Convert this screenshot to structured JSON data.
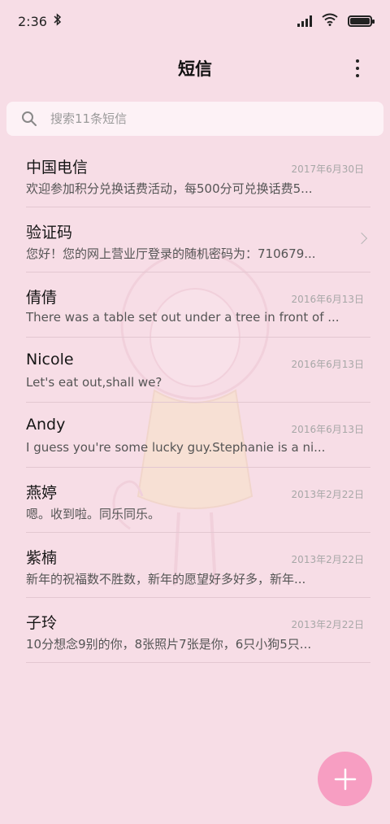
{
  "status_bar": {
    "time": "2:36",
    "bluetooth_icon": "bluetooth-icon",
    "signal_icon": "signal-icon",
    "wifi_icon": "wifi-icon",
    "battery_icon": "battery-icon"
  },
  "header": {
    "title": "短信",
    "menu_icon": "more-vertical-icon"
  },
  "search": {
    "placeholder": "搜索11条短信",
    "icon": "search-icon"
  },
  "messages": [
    {
      "name": "中国电信",
      "date": "2017年6月30日",
      "preview": "欢迎参加积分兑换话费活动，每500分可兑换话费5..."
    },
    {
      "name": "验证码",
      "date": "",
      "preview": "您好！您的网上营业厅登录的随机密码为：710679...",
      "has_chevron": true
    },
    {
      "name": "倩倩",
      "date": "2016年6月13日",
      "preview": "There was a table set out under a tree in front of ..."
    },
    {
      "name": "Nicole",
      "date": "2016年6月13日",
      "preview": "Let's eat out,shall we?"
    },
    {
      "name": "Andy",
      "date": "2016年6月13日",
      "preview": "I guess you're some lucky guy.Stephanie is a ni..."
    },
    {
      "name": "燕婷",
      "date": "2013年2月22日",
      "preview": "嗯。收到啦。同乐同乐。"
    },
    {
      "name": "紫楠",
      "date": "2013年2月22日",
      "preview": "新年的祝福数不胜数，新年的愿望好多好多，新年..."
    },
    {
      "name": "子玲",
      "date": "2013年2月22日",
      "preview": "10分想念9别的你，8张照片7张是你，6只小狗5只..."
    }
  ],
  "fab": {
    "icon": "plus-icon"
  },
  "colors": {
    "background": "#f7dde6",
    "fab": "#f79ec2",
    "divider": "#e3c7d1"
  }
}
